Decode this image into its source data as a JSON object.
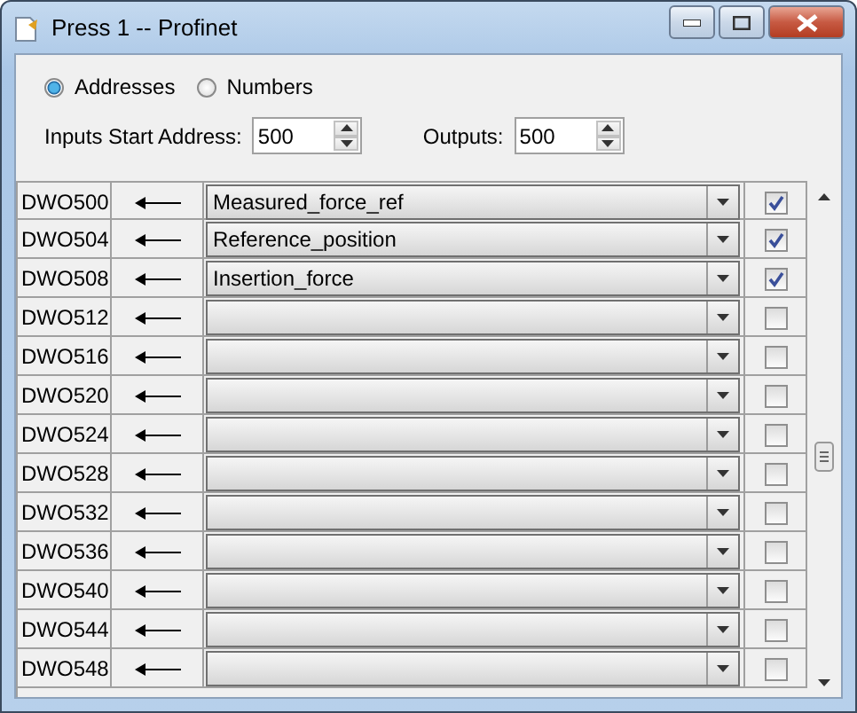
{
  "window": {
    "title": "Press 1 -- Profinet"
  },
  "mode_options": [
    {
      "label": "Addresses",
      "selected": true
    },
    {
      "label": "Numbers",
      "selected": false
    }
  ],
  "inputs_start_address": {
    "label": "Inputs Start Address:",
    "value": "500"
  },
  "outputs": {
    "label": "Outputs:",
    "value": "500"
  },
  "rows": [
    {
      "address": "DWO500",
      "signal": "Measured_force_ref",
      "checked": true
    },
    {
      "address": "DWO504",
      "signal": "Reference_position",
      "checked": true
    },
    {
      "address": "DWO508",
      "signal": "Insertion_force",
      "checked": true
    },
    {
      "address": "DWO512",
      "checked": false
    },
    {
      "address": "DWO516",
      "checked": false
    },
    {
      "address": "DWO520",
      "checked": false
    },
    {
      "address": "DWO524",
      "checked": false
    },
    {
      "address": "DWO528",
      "checked": false
    },
    {
      "address": "DWO532",
      "checked": false
    },
    {
      "address": "DWO536",
      "checked": false
    },
    {
      "address": "DWO540",
      "checked": false
    },
    {
      "address": "DWO544",
      "checked": false
    },
    {
      "address": "DWO548",
      "checked": false
    }
  ]
}
